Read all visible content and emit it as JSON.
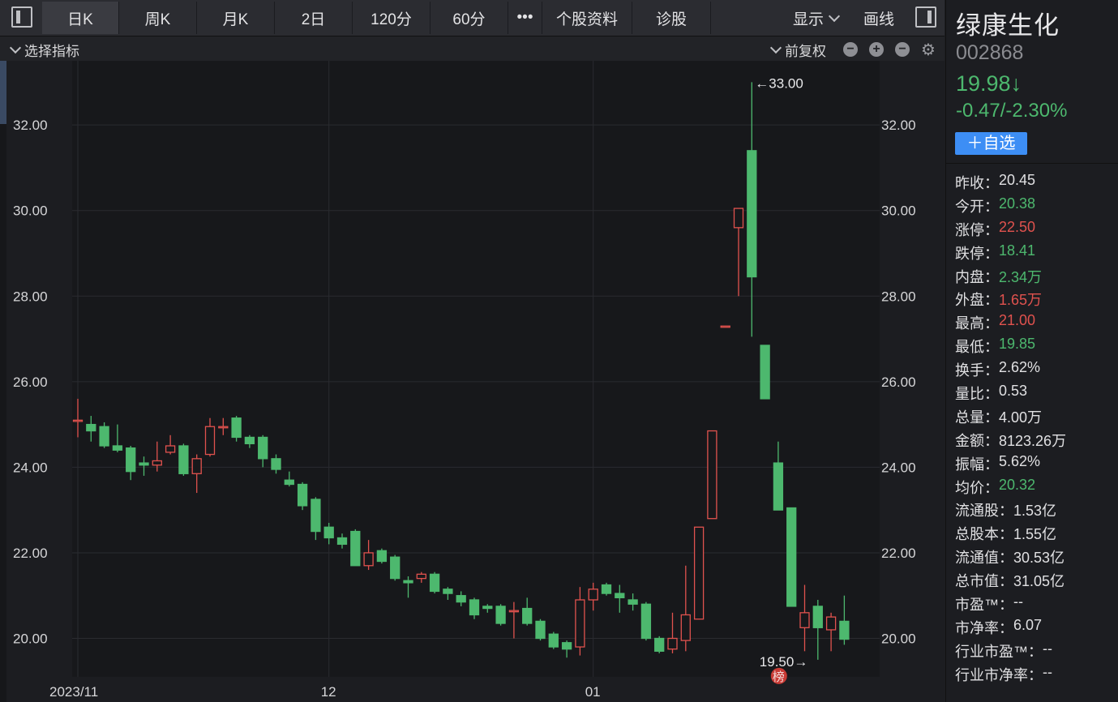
{
  "toolbar": {
    "tabs": [
      "日K",
      "周K",
      "月K",
      "2日",
      "120分",
      "60分",
      "•••",
      "个股资料",
      "诊股"
    ],
    "active_tab": "日K",
    "display_label": "显示",
    "draw_label": "画线"
  },
  "subbar": {
    "indicator_label": "选择指标",
    "adjust_label": "前复权",
    "zoom_out": "−",
    "zoom_in": "+",
    "minimize": "−"
  },
  "stock": {
    "name": "绿康生化",
    "code": "002868",
    "price": "19.98↓",
    "change": "-0.47/-2.30%",
    "watch_button": "＋自选"
  },
  "stats": [
    {
      "label": "昨收：",
      "value": "20.45",
      "tone": "neutral"
    },
    {
      "label": "今开：",
      "value": "20.38",
      "tone": "down"
    },
    {
      "label": "涨停：",
      "value": "22.50",
      "tone": "up"
    },
    {
      "label": "跌停：",
      "value": "18.41",
      "tone": "down"
    },
    {
      "label": "内盘：",
      "value": "2.34万",
      "tone": "down"
    },
    {
      "label": "外盘：",
      "value": "1.65万",
      "tone": "up"
    },
    {
      "label": "最高：",
      "value": "21.00",
      "tone": "up"
    },
    {
      "label": "最低：",
      "value": "19.85",
      "tone": "down"
    },
    {
      "label": "换手：",
      "value": "2.62%",
      "tone": "neutral"
    },
    {
      "label": "量比：",
      "value": "0.53",
      "tone": "neutral"
    },
    {
      "label": "总量：",
      "value": "4.00万",
      "tone": "neutral"
    },
    {
      "label": "金额：",
      "value": "8123.26万",
      "tone": "neutral"
    },
    {
      "label": "振幅：",
      "value": "5.62%",
      "tone": "neutral"
    },
    {
      "label": "均价：",
      "value": "20.32",
      "tone": "down"
    },
    {
      "label": "流通股：",
      "value": "1.53亿",
      "tone": "neutral"
    },
    {
      "label": "总股本：",
      "value": "1.55亿",
      "tone": "neutral"
    },
    {
      "label": "流通值：",
      "value": "30.53亿",
      "tone": "neutral"
    },
    {
      "label": "总市值：",
      "value": "31.05亿",
      "tone": "neutral"
    },
    {
      "label": "市盈™：",
      "value": "--",
      "tone": "neutral"
    },
    {
      "label": "市净率：",
      "value": "6.07",
      "tone": "neutral"
    },
    {
      "label": "行业市盈™：",
      "value": "--",
      "tone": "neutral"
    },
    {
      "label": "行业市净率：",
      "value": "--",
      "tone": "neutral"
    }
  ],
  "colors": {
    "up": "#e0524e",
    "down": "#4db86e",
    "background": "#1c1d21",
    "grid": "#2a2b30",
    "accent": "#3d8ef5"
  },
  "chart_data": {
    "type": "candlestick",
    "y_ticks": [
      "32.00",
      "30.00",
      "28.00",
      "26.00",
      "24.00",
      "22.00",
      "20.00"
    ],
    "y_tick_values": [
      32,
      30,
      28,
      26,
      24,
      22,
      20
    ],
    "ylim": [
      19.1,
      33.5
    ],
    "x_labels": [
      {
        "text": "2023/11",
        "index": 0
      },
      {
        "text": "12",
        "index": 19
      },
      {
        "text": "01",
        "index": 39
      }
    ],
    "max_label": "←33.00",
    "min_label": "19.50→",
    "badge": "榜",
    "candles": [
      [
        25.1,
        25.1,
        25.6,
        24.7
      ],
      [
        25.0,
        24.85,
        25.2,
        24.6
      ],
      [
        24.95,
        24.5,
        25.05,
        24.45
      ],
      [
        24.5,
        24.4,
        25.0,
        24.35
      ],
      [
        24.45,
        23.9,
        24.5,
        23.7
      ],
      [
        24.1,
        24.05,
        24.25,
        23.8
      ],
      [
        24.05,
        24.15,
        24.6,
        23.9
      ],
      [
        24.35,
        24.5,
        24.75,
        24.3
      ],
      [
        24.5,
        23.85,
        24.55,
        23.8
      ],
      [
        23.85,
        24.2,
        24.3,
        23.4
      ],
      [
        24.3,
        24.95,
        25.15,
        24.25
      ],
      [
        24.95,
        24.95,
        25.15,
        24.75
      ],
      [
        25.15,
        24.7,
        25.2,
        24.6
      ],
      [
        24.7,
        24.55,
        24.75,
        24.45
      ],
      [
        24.7,
        24.2,
        24.75,
        24.0
      ],
      [
        24.2,
        23.95,
        24.3,
        23.85
      ],
      [
        23.7,
        23.6,
        23.9,
        23.55
      ],
      [
        23.6,
        23.1,
        23.65,
        23.0
      ],
      [
        23.25,
        22.5,
        23.3,
        22.3
      ],
      [
        22.6,
        22.35,
        22.7,
        22.2
      ],
      [
        22.35,
        22.2,
        22.45,
        22.1
      ],
      [
        22.5,
        21.7,
        22.55,
        21.7
      ],
      [
        21.7,
        22.0,
        22.3,
        21.6
      ],
      [
        22.05,
        21.8,
        22.1,
        21.75
      ],
      [
        21.9,
        21.4,
        21.95,
        21.35
      ],
      [
        21.35,
        21.3,
        21.45,
        20.95
      ],
      [
        21.4,
        21.5,
        21.55,
        21.3
      ],
      [
        21.5,
        21.1,
        21.55,
        21.05
      ],
      [
        21.15,
        21.05,
        21.2,
        20.9
      ],
      [
        21.0,
        20.85,
        21.1,
        20.75
      ],
      [
        20.9,
        20.55,
        20.95,
        20.45
      ],
      [
        20.75,
        20.7,
        20.8,
        20.6
      ],
      [
        20.75,
        20.35,
        20.8,
        20.3
      ],
      [
        20.65,
        20.65,
        20.85,
        20.0
      ],
      [
        20.7,
        20.35,
        20.95,
        20.3
      ],
      [
        20.4,
        20.0,
        20.45,
        19.95
      ],
      [
        20.1,
        19.8,
        20.15,
        19.75
      ],
      [
        19.9,
        19.75,
        19.95,
        19.55
      ],
      [
        19.8,
        20.9,
        21.2,
        19.6
      ],
      [
        20.9,
        21.15,
        21.3,
        20.65
      ],
      [
        21.25,
        21.05,
        21.3,
        21.0
      ],
      [
        21.05,
        20.95,
        21.25,
        20.6
      ],
      [
        20.9,
        20.8,
        21.05,
        20.65
      ],
      [
        20.8,
        20.0,
        20.85,
        19.95
      ],
      [
        20.0,
        19.7,
        20.05,
        19.65
      ],
      [
        19.75,
        20.0,
        20.6,
        19.65
      ],
      [
        19.95,
        20.55,
        21.7,
        19.7
      ],
      [
        20.45,
        22.6,
        22.6,
        20.45
      ],
      [
        22.8,
        24.85,
        24.85,
        22.8
      ],
      [
        27.3,
        27.3,
        27.3,
        27.3
      ],
      [
        29.6,
        30.05,
        30.05,
        28.0
      ],
      [
        31.4,
        28.45,
        33.0,
        27.05
      ],
      [
        26.85,
        25.6,
        26.85,
        25.6
      ],
      [
        24.1,
        23.0,
        24.6,
        23.0
      ],
      [
        23.05,
        20.75,
        23.05,
        20.75
      ],
      [
        20.25,
        20.6,
        21.25,
        19.7
      ],
      [
        20.75,
        20.25,
        20.9,
        19.5
      ],
      [
        20.2,
        20.5,
        20.6,
        19.7
      ],
      [
        20.4,
        19.98,
        21.0,
        19.85
      ]
    ]
  }
}
